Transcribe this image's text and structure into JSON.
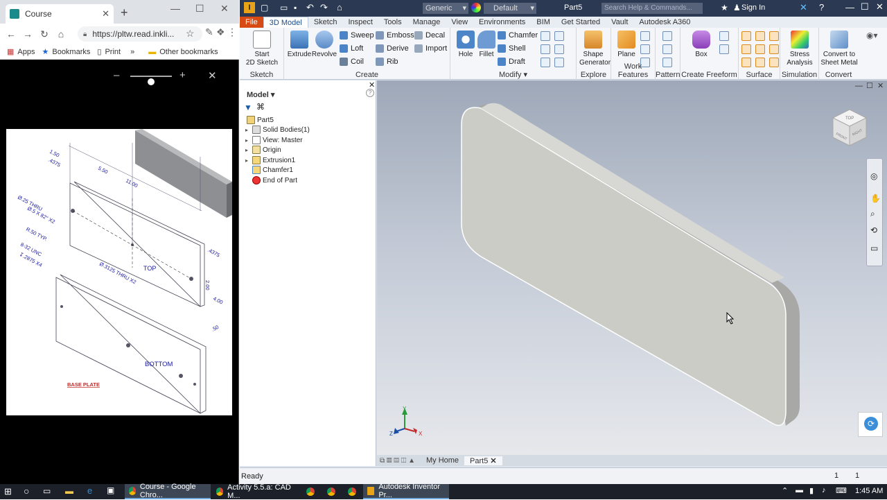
{
  "chrome": {
    "tab_title": "Course",
    "url": "https://pltw.read.inkli...",
    "bookmarks": [
      "Apps",
      "Bookmarks",
      "Print"
    ],
    "bookmarks_overflow": "»",
    "other_bookmarks": "Other bookmarks",
    "viewer": {
      "minus": "–",
      "plus": "+",
      "close": "✕"
    },
    "drawing": {
      "dims": [
        "1.50",
        ".4375",
        "5.50",
        "11.00",
        ".4375",
        "2.00",
        "4.00",
        ".50"
      ],
      "notes": [
        "Ø.25 THRU",
        "Ø.5 X 82° X2",
        "R.50 TYP.",
        "8-32 UNC",
        "↧.2875 X4",
        "Ø.3125 THRU X2"
      ],
      "top_label": "TOP",
      "bottom_label": "BOTTOM",
      "title": "BASE PLATE"
    }
  },
  "inventor": {
    "quick_access": {
      "material": "Generic",
      "appearance": "Default",
      "doc_title": "Part5",
      "search_placeholder": "Search Help & Commands...",
      "sign_in": "Sign In"
    },
    "ribbon_tabs": [
      "File",
      "3D Model",
      "Sketch",
      "Inspect",
      "Tools",
      "Manage",
      "View",
      "Environments",
      "BIM",
      "Get Started",
      "Vault",
      "Autodesk A360"
    ],
    "panels": {
      "sketch": {
        "name": "Sketch",
        "start_sketch": "Start\n2D Sketch"
      },
      "create": {
        "name": "Create",
        "extrude": "Extrude",
        "revolve": "Revolve",
        "sweep": "Sweep",
        "emboss": "Emboss",
        "decal": "Decal",
        "loft": "Loft",
        "derive": "Derive",
        "import": "Import",
        "coil": "Coil",
        "rib": "Rib"
      },
      "modify": {
        "name": "Modify",
        "hole": "Hole",
        "fillet": "Fillet",
        "chamfer": "Chamfer",
        "shell": "Shell",
        "draft": "Draft"
      },
      "explore": {
        "name": "Explore",
        "shape_generator": "Shape\nGenerator"
      },
      "work_features": {
        "name": "Work Features",
        "plane": "Plane"
      },
      "pattern": {
        "name": "Pattern"
      },
      "freeform": {
        "name": "Create Freeform",
        "box": "Box"
      },
      "surface": {
        "name": "Surface"
      },
      "simulation": {
        "name": "Simulation",
        "stress": "Stress\nAnalysis"
      },
      "convert": {
        "name": "Convert",
        "sheet_metal": "Convert to\nSheet Metal"
      }
    },
    "browser": {
      "header": "Model",
      "items": [
        {
          "label": "Part5",
          "expandable": false,
          "indent": 0
        },
        {
          "label": "Solid Bodies(1)",
          "expandable": true,
          "indent": 1
        },
        {
          "label": "View: Master",
          "expandable": true,
          "indent": 1
        },
        {
          "label": "Origin",
          "expandable": true,
          "indent": 1
        },
        {
          "label": "Extrusion1",
          "expandable": true,
          "indent": 1
        },
        {
          "label": "Chamfer1",
          "expandable": false,
          "indent": 1
        },
        {
          "label": "End of Part",
          "expandable": false,
          "indent": 1
        }
      ]
    },
    "viewcube": {
      "top": "TOP",
      "front": "FRONT",
      "right": "RIGHT"
    },
    "doc_tabs": [
      "My Home",
      "Part5"
    ],
    "status": {
      "text": "Ready",
      "count1": "1",
      "count2": "1"
    },
    "axis": {
      "x": "X",
      "y": "Y",
      "z": "Z"
    }
  },
  "taskbar": {
    "items": [
      "Course - Google Chro...",
      "Activity 5.5.a: CAD M...",
      "Autodesk Inventor Pr..."
    ],
    "time": "1:45 AM"
  }
}
